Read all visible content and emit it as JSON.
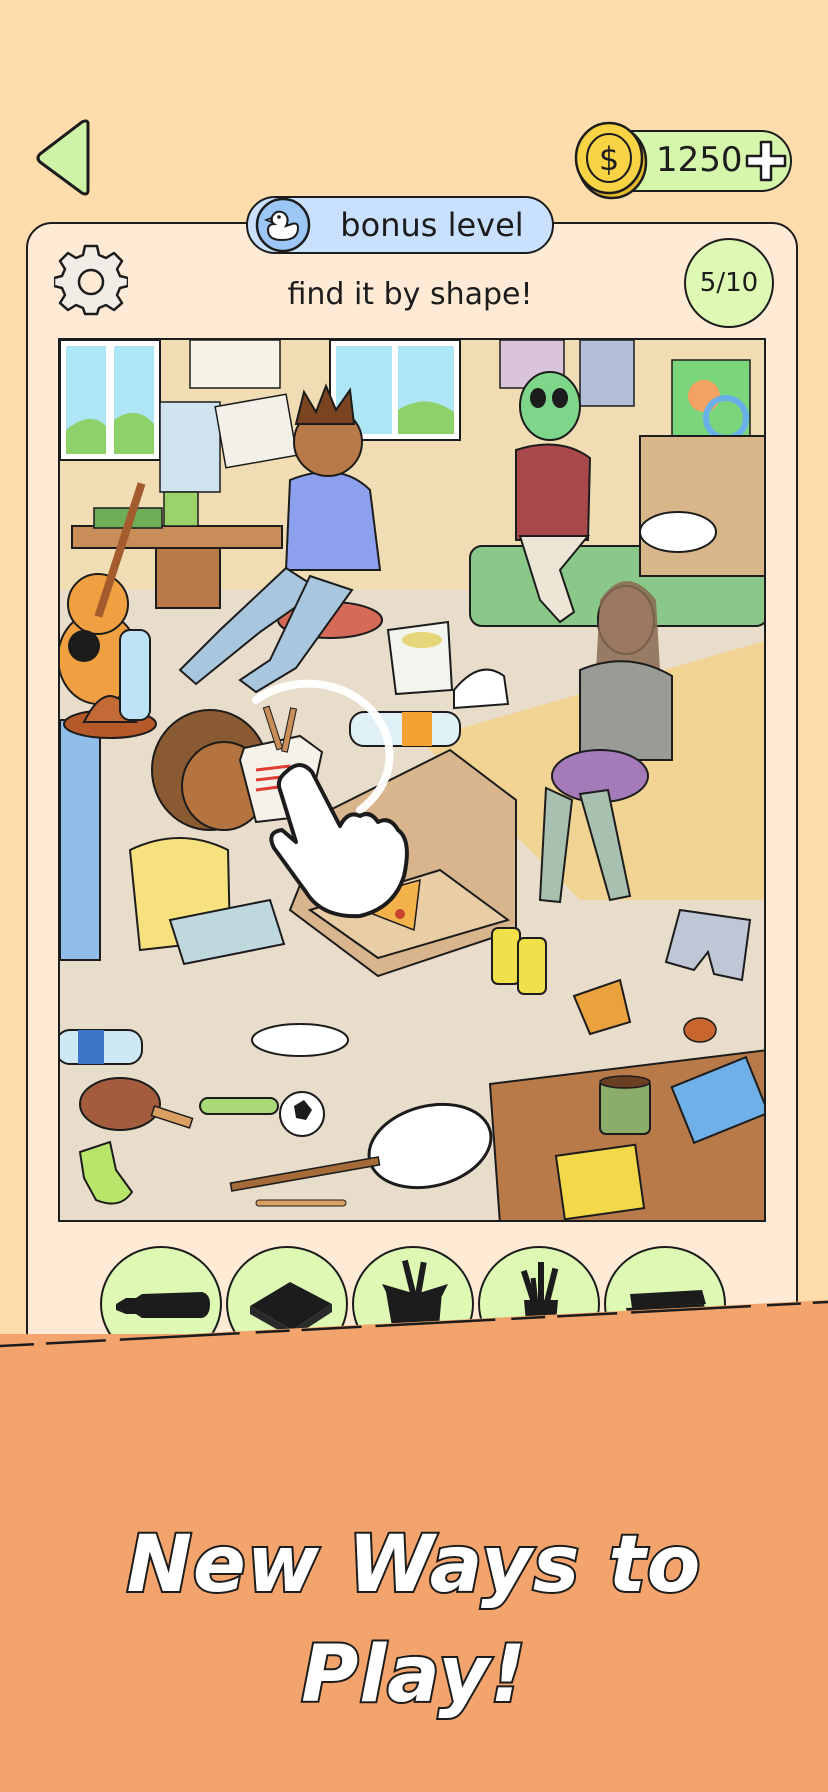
{
  "header": {
    "back_icon": "back-triangle-icon",
    "coins": "1250",
    "coin_icon": "dollar-coin-icon",
    "add_icon": "plus-icon"
  },
  "card": {
    "bonus_label": "bonus level",
    "badge_icon": "duck-icon",
    "settings_icon": "gear-icon",
    "instruction": "find it by shape!",
    "progress": "5/10"
  },
  "targets": [
    {
      "icon": "water-bottle-silhouette-icon"
    },
    {
      "icon": "notepad-silhouette-icon"
    },
    {
      "icon": "takeout-box-silhouette-icon"
    },
    {
      "icon": "pen-cup-silhouette-icon"
    },
    {
      "icon": "stacked-books-silhouette-icon"
    }
  ],
  "banner": {
    "title": "New Ways to Play!"
  },
  "colors": {
    "background": "#FFDCAB",
    "card": "#FFEBD5",
    "accent_green": "#D6F7AB",
    "pill_blue": "#C9E1FF",
    "banner": "#F3A46C"
  }
}
